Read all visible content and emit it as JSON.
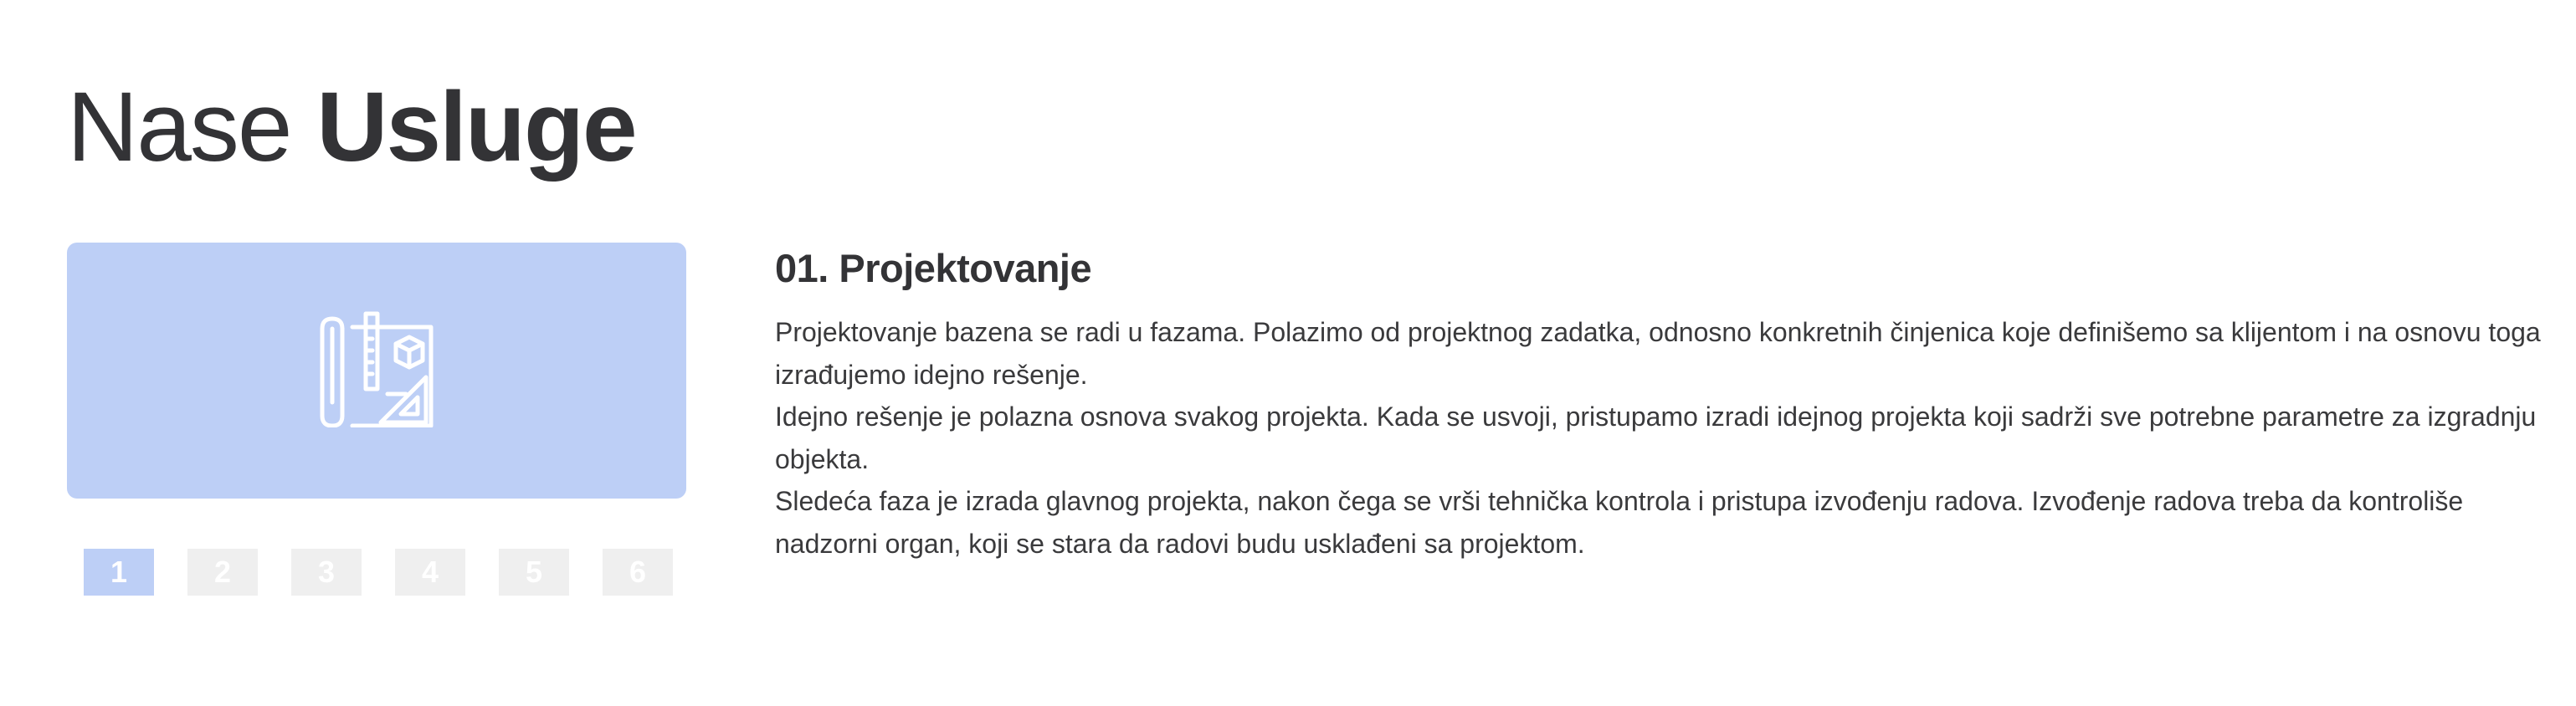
{
  "header": {
    "title_regular": "Nase",
    "title_bold": "Usluge"
  },
  "service": {
    "icon": "blueprint-design-icon",
    "title": "01. Projektovanje",
    "paragraphs": [
      "Projektovanje bazena se radi u fazama. Polazimo od projektnog zadatka, odnosno konkretnih činjenica koje definišemo sa klijentom i na osnovu toga izrađujemo idejno rešenje.",
      "Idejno rešenje je polazna osnova svakog projekta. Kada se usvoji, pristupamo izradi idejnog projekta koji sadrži sve potrebne parametre za izgradnju objekta.",
      "Sledeća faza je izrada glavnog projekta, nakon čega se vrši tehnička kontrola i pristupa izvođenju radova. Izvođenje radova treba da kontroliše nadzorni organ, koji se stara da radovi budu usklađeni sa projektom."
    ]
  },
  "pager": {
    "active": "1",
    "pages": [
      "1",
      "2",
      "3",
      "4",
      "5",
      "6"
    ]
  },
  "colors": {
    "accent": "#bdcff6",
    "inactive": "#efefef",
    "text": "#3a3a3c"
  }
}
